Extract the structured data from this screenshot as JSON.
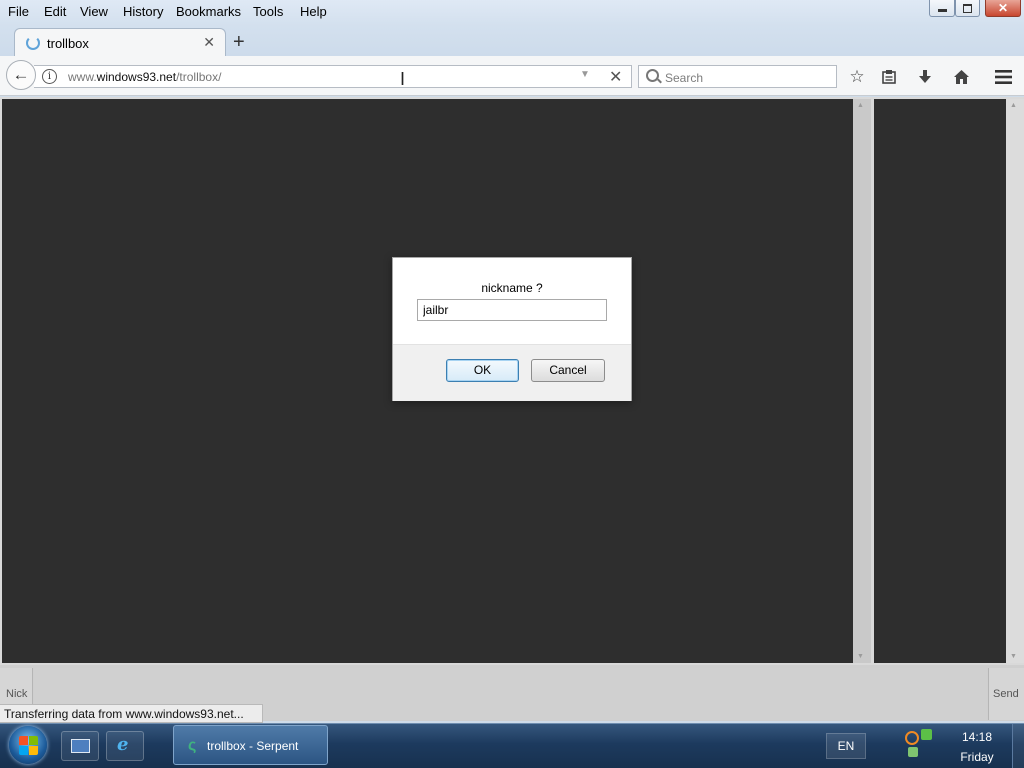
{
  "menu": {
    "file": "File",
    "edit": "Edit",
    "view": "View",
    "history": "History",
    "bookmarks": "Bookmarks",
    "tools": "Tools",
    "help": "Help"
  },
  "tab": {
    "title": "trollbox",
    "new_tab": "+"
  },
  "urlbar": {
    "url_prefix": "www.",
    "url_domain": "windows93.net",
    "url_path": "/trollbox/"
  },
  "search": {
    "placeholder": "Search"
  },
  "page": {
    "nick_label": "Nick",
    "send_label": "Send",
    "status": "Transferring data from www.windows93.net..."
  },
  "dialog": {
    "question": "nickname ?",
    "input_value": "jailbr",
    "ok_label": "OK",
    "cancel_label": "Cancel"
  },
  "taskbar": {
    "task_title": "trollbox - Serpent",
    "language": "EN",
    "time": "14:18",
    "day": "Friday"
  },
  "icons": {
    "back": "back-arrow-icon",
    "info": "info-icon",
    "search": "search-icon",
    "bookmark": "star-icon",
    "library": "clipboard-icon",
    "downloads": "download-icon",
    "home": "home-icon",
    "menu": "hamburger-menu-icon"
  },
  "colors": {
    "chat_background": "#2e2e2e",
    "taskbar": "#1d3a5e",
    "ok_button_border": "#3c7fb1"
  }
}
